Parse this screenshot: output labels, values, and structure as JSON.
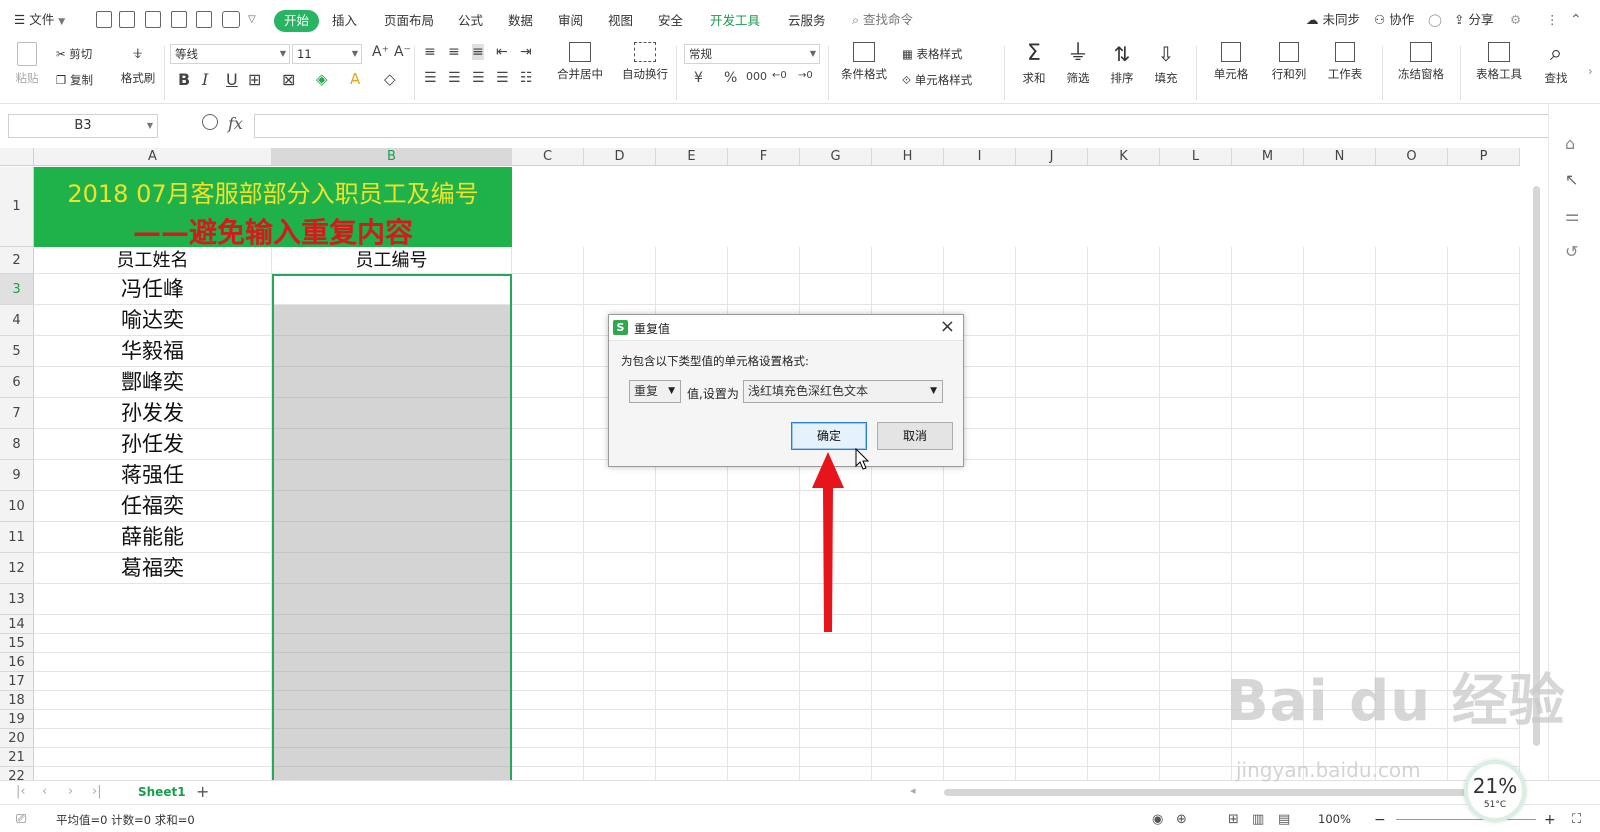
{
  "topbar": {
    "menu_label": "文件",
    "tabs": [
      {
        "label": "开始"
      },
      {
        "label": "插入"
      },
      {
        "label": "页面布局"
      },
      {
        "label": "公式"
      },
      {
        "label": "数据"
      },
      {
        "label": "审阅"
      },
      {
        "label": "视图"
      },
      {
        "label": "安全"
      },
      {
        "label": "开发工具"
      },
      {
        "label": "云服务"
      }
    ],
    "search_label": "查找命令",
    "sync_label": "未同步",
    "collab_label": "协作",
    "share_label": "分享"
  },
  "ribbon": {
    "paste": "粘贴",
    "cut": "剪切",
    "copy": "复制",
    "format_painter": "格式刷",
    "font_name": "等线",
    "font_size": "11",
    "merge_center": "合并居中",
    "wrap_text": "自动换行",
    "number_format": "常规",
    "currency": "¥",
    "percent": "%",
    "thousands": "000",
    "cond_format": "条件格式",
    "table_style": "表格样式",
    "cell_style": "单元格样式",
    "sum": "求和",
    "filter": "筛选",
    "sort": "排序",
    "fill": "填充",
    "cell": "单元格",
    "row_col": "行和列",
    "worksheet": "工作表",
    "freeze": "冻结窗格",
    "table_tools": "表格工具",
    "find": "查找"
  },
  "formula_bar": {
    "name_box": "B3",
    "fx_label": "fx",
    "formula": ""
  },
  "grid": {
    "columns": [
      "A",
      "B",
      "C",
      "D",
      "E",
      "F",
      "G",
      "H",
      "I",
      "J",
      "K",
      "L",
      "M",
      "N",
      "O",
      "P"
    ],
    "title_line1": "2018 07月客服部部分入职员工及编号",
    "title_line2": "——避免输入重复内容",
    "header_name": "员工姓名",
    "header_id": "员工编号",
    "names": [
      "冯任峰",
      "喻达奕",
      "华毅福",
      "酆峰奕",
      "孙发发",
      "孙任发",
      "蒋强任",
      "任福奕",
      "薛能能",
      "葛福奕"
    ],
    "row_numbers": [
      "1",
      "2",
      "3",
      "4",
      "5",
      "6",
      "7",
      "8",
      "9",
      "10",
      "11",
      "12",
      "13",
      "14",
      "15",
      "16",
      "17",
      "18",
      "19",
      "20",
      "21",
      "22"
    ]
  },
  "dialog": {
    "title": "重复值",
    "prompt": "为包含以下类型值的单元格设置格式:",
    "type_value": "重复",
    "middle_label": "值,设置为",
    "format_value": "浅红填充色深红色文本",
    "ok_label": "确定",
    "cancel_label": "取消"
  },
  "sheets": {
    "active": "Sheet1"
  },
  "status": {
    "stats": "平均值=0  计数=0  求和=0",
    "zoom": "100%"
  },
  "overlay": {
    "watermark": "Bai du 经验",
    "watermark_url": "jingyan.baidu.com",
    "perf_percent": "21%",
    "perf_temp": "51°C"
  },
  "colors": {
    "accent": "#28b463",
    "title_bg": "#1fb14a",
    "title_text1": "#f0e22a",
    "title_text2": "#d41a1a",
    "selection_fill": "#d4d4d4",
    "arrow": "#e8141c"
  }
}
